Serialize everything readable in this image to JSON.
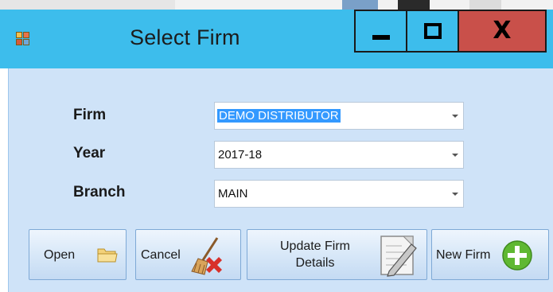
{
  "window": {
    "title": "Select Firm",
    "icons": {
      "app": "app-icon",
      "minimize": "minimize-icon",
      "maximize": "maximize-icon",
      "close": "close-icon"
    },
    "close_glyph": "X"
  },
  "form": {
    "firm": {
      "label": "Firm",
      "value": "DEMO DISTRIBUTOR"
    },
    "year": {
      "label": "Year",
      "value": "2017-18"
    },
    "branch": {
      "label": "Branch",
      "value": "MAIN"
    }
  },
  "buttons": {
    "open": {
      "label": "Open",
      "icon": "folder-icon"
    },
    "cancel": {
      "label": "Cancel",
      "icon": "broom-cancel-icon"
    },
    "update": {
      "label_line1": "Update Firm",
      "label_line2": "Details",
      "icon": "notepad-pencil-icon"
    },
    "new_firm": {
      "label": "New Firm",
      "icon": "plus-circle-icon"
    }
  },
  "colors": {
    "titlebar": "#3dbdec",
    "close_button": "#c9504a",
    "client_background": "#cfe3f8",
    "selection": "#3399ff"
  }
}
